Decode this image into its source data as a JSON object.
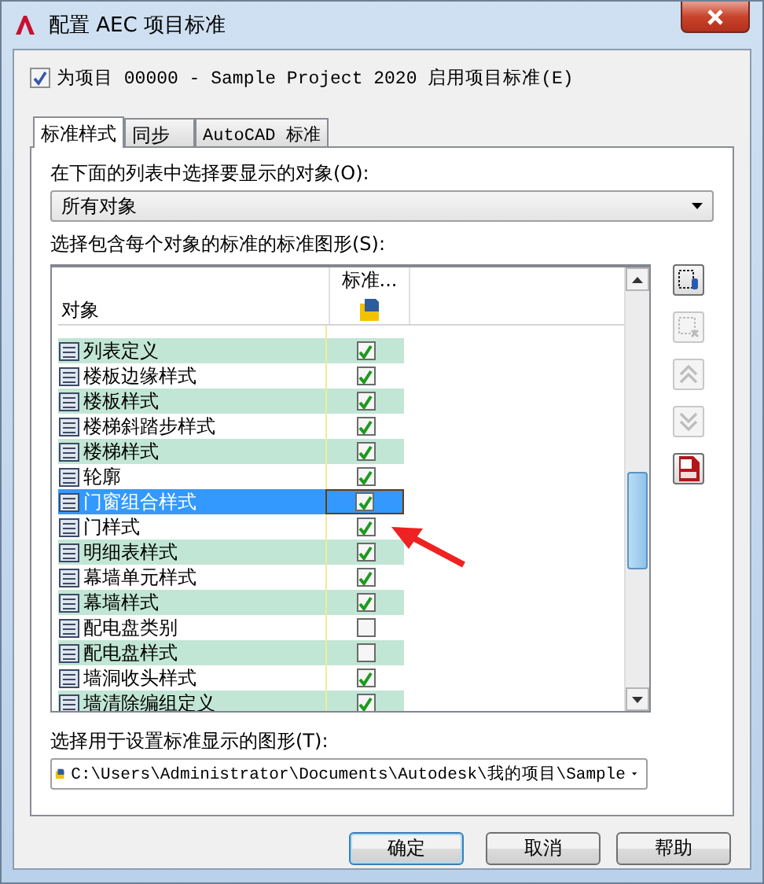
{
  "window": {
    "title": "配置 AEC 项目标准"
  },
  "enable_standards": {
    "label": "为项目 00000 - Sample Project 2020 启用项目标准(E)",
    "checked": true
  },
  "tabs": [
    {
      "label": "标准样式",
      "selected": true
    },
    {
      "label": "同步",
      "selected": false
    },
    {
      "label": "AutoCAD 标准",
      "selected": false
    }
  ],
  "object_filter": {
    "label": "在下面的列表中选择要显示的对象(O):",
    "value": "所有对象"
  },
  "standards_list": {
    "label": "选择包含每个对象的标准的标准图形(S):",
    "columns": [
      "对象",
      "标准..."
    ],
    "rows": [
      {
        "name": "列表定义",
        "checked": true,
        "selected": false
      },
      {
        "name": "楼板边缘样式",
        "checked": true,
        "selected": false
      },
      {
        "name": "楼板样式",
        "checked": true,
        "selected": false
      },
      {
        "name": "楼梯斜踏步样式",
        "checked": true,
        "selected": false
      },
      {
        "name": "楼梯样式",
        "checked": true,
        "selected": false
      },
      {
        "name": "轮廓",
        "checked": true,
        "selected": false
      },
      {
        "name": "门窗组合样式",
        "checked": true,
        "selected": true
      },
      {
        "name": "门样式",
        "checked": true,
        "selected": false
      },
      {
        "name": "明细表样式",
        "checked": true,
        "selected": false
      },
      {
        "name": "幕墙单元样式",
        "checked": true,
        "selected": false
      },
      {
        "name": "幕墙样式",
        "checked": true,
        "selected": false
      },
      {
        "name": "配电盘类别",
        "checked": false,
        "selected": false
      },
      {
        "name": "配电盘样式",
        "checked": false,
        "selected": false
      },
      {
        "name": "墙洞收头样式",
        "checked": true,
        "selected": false
      },
      {
        "name": "墙清除编组定义",
        "checked": true,
        "selected": false
      }
    ]
  },
  "side_buttons": [
    {
      "kind": "attach",
      "disabled": false
    },
    {
      "kind": "remove",
      "disabled": true
    },
    {
      "kind": "up",
      "disabled": true
    },
    {
      "kind": "down",
      "disabled": true
    },
    {
      "kind": "pdf",
      "disabled": false
    }
  ],
  "display_drawing": {
    "label": "选择用于设置标准显示的图形(T):",
    "value": "C:\\Users\\Administrator\\Documents\\Autodesk\\我的项目\\Sample"
  },
  "buttons": [
    {
      "label": "确定",
      "default": true
    },
    {
      "label": "取消",
      "default": false
    },
    {
      "label": "帮助",
      "default": false
    }
  ]
}
